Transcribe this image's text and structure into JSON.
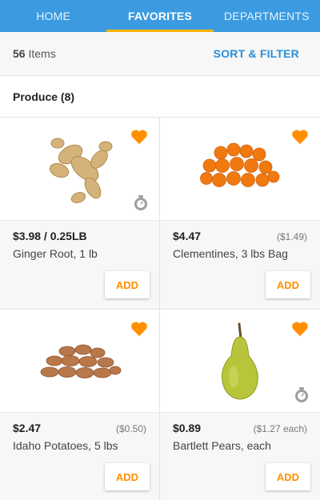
{
  "tabs": [
    {
      "label": "HOME"
    },
    {
      "label": "FAVORITES",
      "active": true
    },
    {
      "label": "DEPARTMENTS"
    }
  ],
  "summary": {
    "count": "56",
    "count_suffix": " Items",
    "sort_label": "SORT & FILTER"
  },
  "section": {
    "title": "Produce (8)"
  },
  "products": [
    {
      "price": "$3.98 / 0.25LB",
      "unit_price": "",
      "name": "Ginger Root, 1 lb",
      "add_label": "ADD",
      "image_icon": "ginger-image",
      "favorited": true,
      "sold_by_weight": true
    },
    {
      "price": "$4.47",
      "unit_price": "($1.49)",
      "name": "Clementines, 3 lbs Bag",
      "add_label": "ADD",
      "image_icon": "clementines-image",
      "favorited": true,
      "sold_by_weight": false
    },
    {
      "price": "$2.47",
      "unit_price": "($0.50)",
      "name": "Idaho Potatoes, 5 lbs",
      "add_label": "ADD",
      "image_icon": "potatoes-image",
      "favorited": true,
      "sold_by_weight": false
    },
    {
      "price": "$0.89",
      "unit_price": "($1.27 each)",
      "name": "Bartlett Pears, each",
      "add_label": "ADD",
      "image_icon": "pear-image",
      "favorited": true,
      "sold_by_weight": true
    }
  ],
  "colors": {
    "header_bg": "#3c9be0",
    "tab_indicator": "#ffb300",
    "accent_orange": "#ff8f00",
    "link_blue": "#2a8ed6"
  }
}
